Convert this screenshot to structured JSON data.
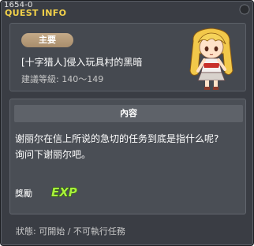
{
  "window": {
    "id_label": "1654-0",
    "title": "QUEST INFO"
  },
  "header": {
    "category_badge": "主要",
    "quest_name": "[十字猎人]侵入玩具村的黑暗",
    "level_label": "建議等級",
    "level_value": "140～149"
  },
  "content": {
    "section_title": "內容",
    "description_line1": "谢丽尔在信上所说的急切的任务到底是指什么呢?",
    "description_line2": "询问下谢丽尔吧。",
    "reward_label": "獎勵",
    "reward_icon_text": "EXP"
  },
  "status": {
    "label": "狀態",
    "value": "可開始 / 不可執行任務"
  },
  "colors": {
    "title_yellow": "#f3d24a",
    "badge": "#b89a78",
    "exp_green": "#a8f03c"
  }
}
